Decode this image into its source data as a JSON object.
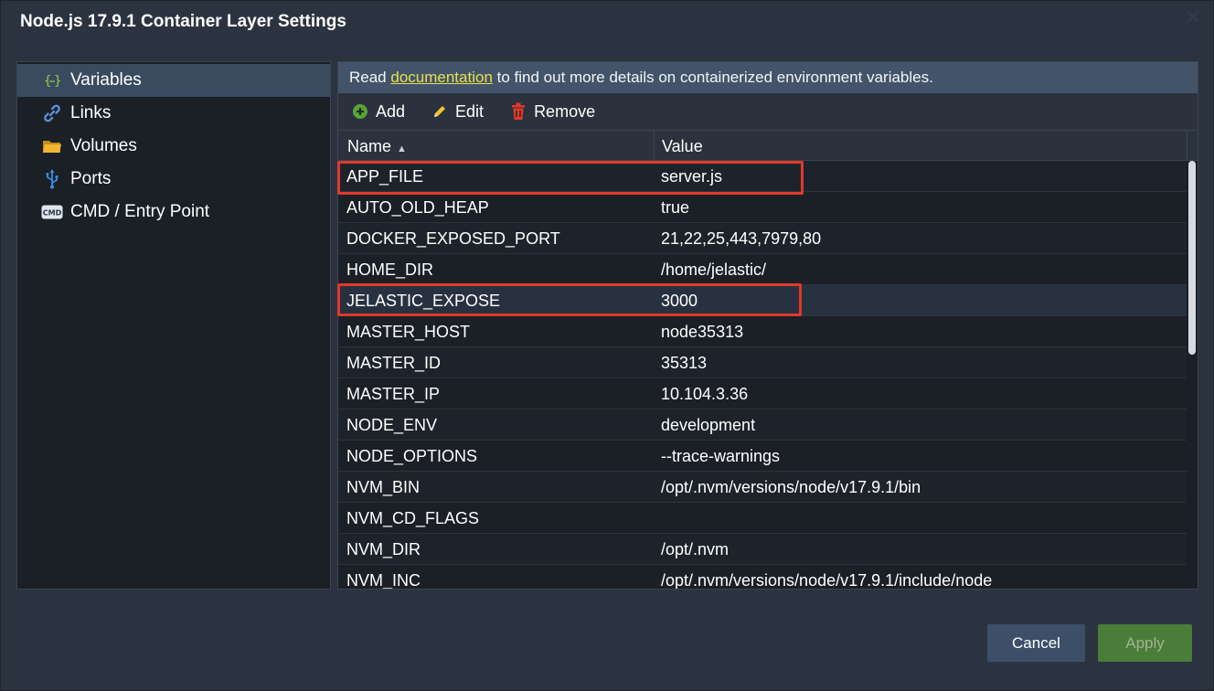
{
  "window": {
    "title": "Node.js 17.9.1 Container Layer Settings",
    "close_icon": "×"
  },
  "sidebar": {
    "items": [
      {
        "label": "Variables",
        "icon": "braces-icon",
        "active": true
      },
      {
        "label": "Links",
        "icon": "link-icon",
        "active": false
      },
      {
        "label": "Volumes",
        "icon": "folder-icon",
        "active": false
      },
      {
        "label": "Ports",
        "icon": "usb-icon",
        "active": false
      },
      {
        "label": "CMD / Entry Point",
        "icon": "cmd-icon",
        "active": false
      }
    ]
  },
  "info": {
    "prefix": "Read ",
    "link_text": "documentation",
    "suffix": " to find out more details on containerized environment variables."
  },
  "toolbar": {
    "add_label": "Add",
    "edit_label": "Edit",
    "remove_label": "Remove"
  },
  "table": {
    "columns": [
      "Name",
      "Value"
    ],
    "sort": "ascending",
    "rows": [
      {
        "name": "APP_FILE",
        "value": "server.js"
      },
      {
        "name": "AUTO_OLD_HEAP",
        "value": "true"
      },
      {
        "name": "DOCKER_EXPOSED_PORT",
        "value": "21,22,25,443,7979,80"
      },
      {
        "name": "HOME_DIR",
        "value": "/home/jelastic/"
      },
      {
        "name": "JELASTIC_EXPOSE",
        "value": "3000"
      },
      {
        "name": "MASTER_HOST",
        "value": "node35313"
      },
      {
        "name": "MASTER_ID",
        "value": "35313"
      },
      {
        "name": "MASTER_IP",
        "value": "10.104.3.36"
      },
      {
        "name": "NODE_ENV",
        "value": "development"
      },
      {
        "name": "NODE_OPTIONS",
        "value": "--trace-warnings"
      },
      {
        "name": "NVM_BIN",
        "value": "/opt/.nvm/versions/node/v17.9.1/bin"
      },
      {
        "name": "NVM_CD_FLAGS",
        "value": ""
      },
      {
        "name": "NVM_DIR",
        "value": "/opt/.nvm"
      },
      {
        "name": "NVM_INC",
        "value": "/opt/.nvm/versions/node/v17.9.1/include/node"
      }
    ],
    "selected_row": "JELASTIC_EXPOSE",
    "highlighted_rows": [
      "APP_FILE",
      "JELASTIC_EXPOSE"
    ]
  },
  "footer": {
    "cancel_label": "Cancel",
    "apply_label": "Apply"
  },
  "colors": {
    "accent_link": "#e8e04a",
    "highlight_border": "#e0392b",
    "apply_button": "#4a7c3a",
    "cancel_button": "#3d4f68"
  }
}
